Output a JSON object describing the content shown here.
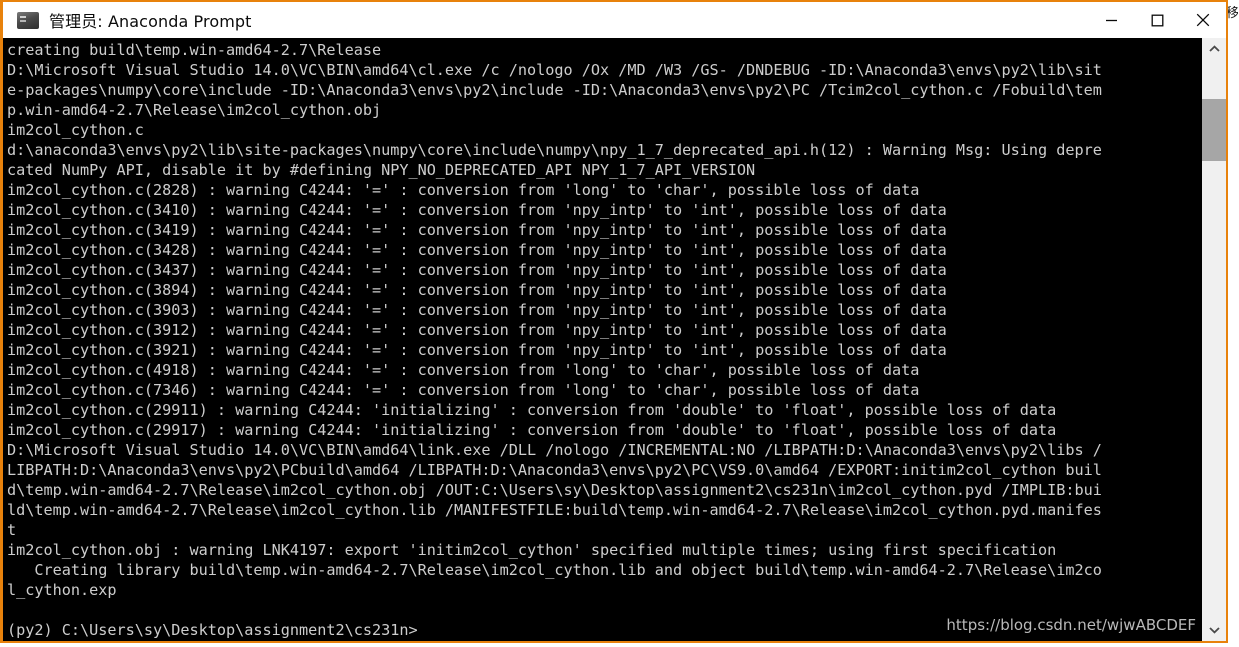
{
  "window": {
    "title": "管理员: Anaconda Prompt",
    "icon": "console-icon",
    "border_color": "#e8820c",
    "controls": [
      {
        "name": "minimize-button",
        "glyph": "minimize-icon",
        "label": "最小化"
      },
      {
        "name": "maximize-button",
        "glyph": "maximize-icon",
        "label": "最大化"
      },
      {
        "name": "close-button",
        "glyph": "close-icon",
        "label": "关闭"
      }
    ]
  },
  "desktop": {
    "sliver_text": "移动"
  },
  "terminal": {
    "background": "#000000",
    "foreground": "#cdcdcd",
    "lines": [
      "creating build\\temp.win-amd64-2.7\\Release",
      "D:\\Microsoft Visual Studio 14.0\\VC\\BIN\\amd64\\cl.exe /c /nologo /Ox /MD /W3 /GS- /DNDEBUG -ID:\\Anaconda3\\envs\\py2\\lib\\sit",
      "e-packages\\numpy\\core\\include -ID:\\Anaconda3\\envs\\py2\\include -ID:\\Anaconda3\\envs\\py2\\PC /Tcim2col_cython.c /Fobuild\\tem",
      "p.win-amd64-2.7\\Release\\im2col_cython.obj",
      "im2col_cython.c",
      "d:\\anaconda3\\envs\\py2\\lib\\site-packages\\numpy\\core\\include\\numpy\\npy_1_7_deprecated_api.h(12) : Warning Msg: Using depre",
      "cated NumPy API, disable it by #defining NPY_NO_DEPRECATED_API NPY_1_7_API_VERSION",
      "im2col_cython.c(2828) : warning C4244: '=' : conversion from 'long' to 'char', possible loss of data",
      "im2col_cython.c(3410) : warning C4244: '=' : conversion from 'npy_intp' to 'int', possible loss of data",
      "im2col_cython.c(3419) : warning C4244: '=' : conversion from 'npy_intp' to 'int', possible loss of data",
      "im2col_cython.c(3428) : warning C4244: '=' : conversion from 'npy_intp' to 'int', possible loss of data",
      "im2col_cython.c(3437) : warning C4244: '=' : conversion from 'npy_intp' to 'int', possible loss of data",
      "im2col_cython.c(3894) : warning C4244: '=' : conversion from 'npy_intp' to 'int', possible loss of data",
      "im2col_cython.c(3903) : warning C4244: '=' : conversion from 'npy_intp' to 'int', possible loss of data",
      "im2col_cython.c(3912) : warning C4244: '=' : conversion from 'npy_intp' to 'int', possible loss of data",
      "im2col_cython.c(3921) : warning C4244: '=' : conversion from 'npy_intp' to 'int', possible loss of data",
      "im2col_cython.c(4918) : warning C4244: '=' : conversion from 'long' to 'char', possible loss of data",
      "im2col_cython.c(7346) : warning C4244: '=' : conversion from 'long' to 'char', possible loss of data",
      "im2col_cython.c(29911) : warning C4244: 'initializing' : conversion from 'double' to 'float', possible loss of data",
      "im2col_cython.c(29917) : warning C4244: 'initializing' : conversion from 'double' to 'float', possible loss of data",
      "D:\\Microsoft Visual Studio 14.0\\VC\\BIN\\amd64\\link.exe /DLL /nologo /INCREMENTAL:NO /LIBPATH:D:\\Anaconda3\\envs\\py2\\libs /",
      "LIBPATH:D:\\Anaconda3\\envs\\py2\\PCbuild\\amd64 /LIBPATH:D:\\Anaconda3\\envs\\py2\\PC\\VS9.0\\amd64 /EXPORT:initim2col_cython buil",
      "d\\temp.win-amd64-2.7\\Release\\im2col_cython.obj /OUT:C:\\Users\\sy\\Desktop\\assignment2\\cs231n\\im2col_cython.pyd /IMPLIB:bui",
      "ld\\temp.win-amd64-2.7\\Release\\im2col_cython.lib /MANIFESTFILE:build\\temp.win-amd64-2.7\\Release\\im2col_cython.pyd.manifes",
      "t",
      "im2col_cython.obj : warning LNK4197: export 'initim2col_cython' specified multiple times; using first specification",
      "   Creating library build\\temp.win-amd64-2.7\\Release\\im2col_cython.lib and object build\\temp.win-amd64-2.7\\Release\\im2co",
      "l_cython.exp",
      "",
      "(py2) C:\\Users\\sy\\Desktop\\assignment2\\cs231n>"
    ]
  },
  "watermark": {
    "text": "https://blog.csdn.net/wjwABCDEF"
  },
  "scrollbar": {
    "up_arrow": "chevron-up-icon",
    "down_arrow": "chevron-down-icon",
    "thumb_position_pct": 7,
    "thumb_size_pct": 11
  }
}
